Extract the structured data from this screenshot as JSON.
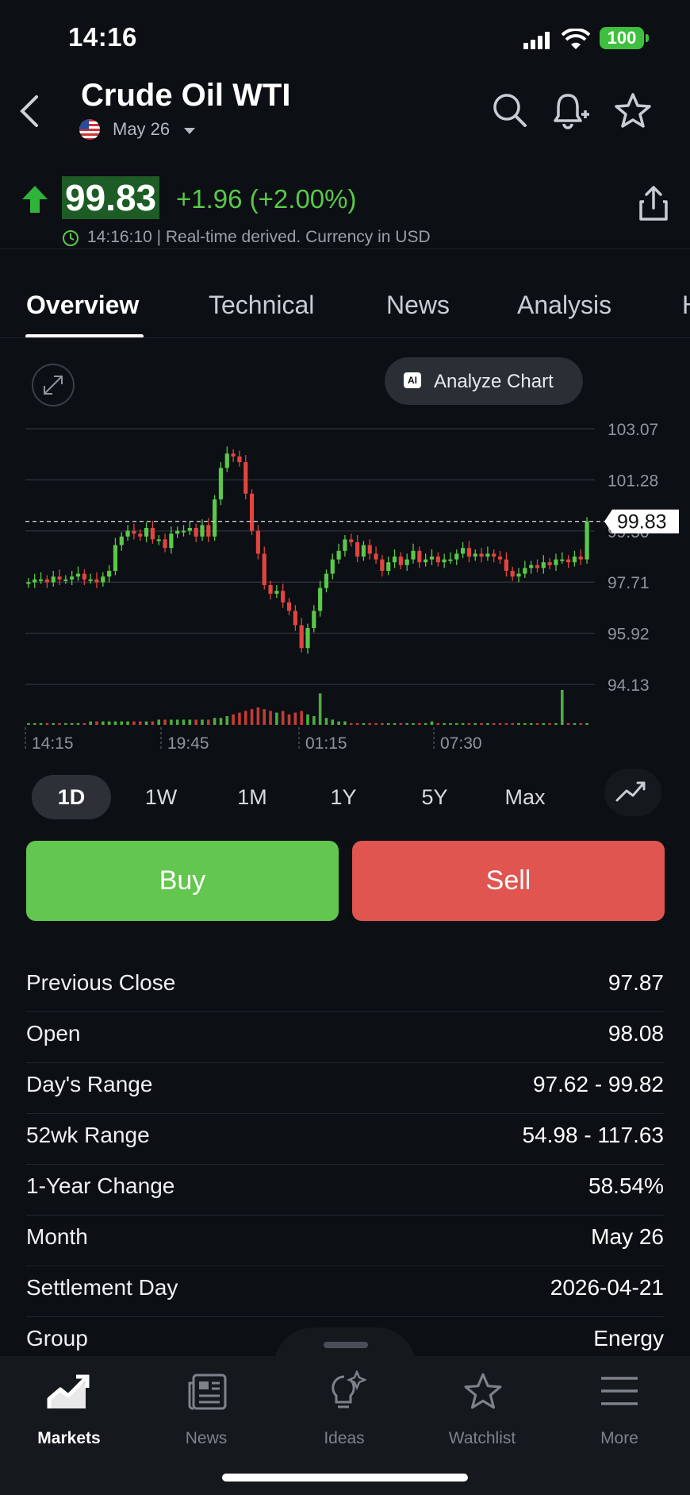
{
  "status_bar": {
    "time": "14:16",
    "battery": "100"
  },
  "header": {
    "title": "Crude Oil WTI",
    "contract": "May 26"
  },
  "quote": {
    "price": "99.83",
    "change": "+1.96 (+2.00%)",
    "meta": "14:16:10 | Real-time derived. Currency in USD",
    "direction": "up",
    "up_color": "#5ac84a",
    "down_color": "#e0453f"
  },
  "tabs": [
    "Overview",
    "Technical",
    "News",
    "Analysis",
    "H"
  ],
  "analyze_button": {
    "badge": "AI",
    "label": "Analyze Chart"
  },
  "chart_data": {
    "type": "candlestick",
    "y_ticks": [
      "103.07",
      "101.28",
      "99.50",
      "97.71",
      "95.92",
      "94.13"
    ],
    "x_ticks": [
      "14:15",
      "19:45",
      "01:15",
      "07:30"
    ],
    "ylim": [
      94.13,
      103.07
    ],
    "current_price_label": "99.83",
    "closes": [
      97.7,
      97.8,
      97.8,
      97.7,
      97.9,
      97.8,
      97.8,
      97.9,
      98.0,
      97.8,
      97.8,
      97.7,
      97.9,
      98.1,
      99.0,
      99.3,
      99.5,
      99.4,
      99.3,
      99.6,
      99.2,
      99.2,
      98.9,
      99.4,
      99.5,
      99.5,
      99.6,
      99.3,
      99.7,
      99.3,
      100.6,
      101.7,
      102.2,
      102.1,
      101.9,
      100.8,
      99.5,
      98.7,
      97.6,
      97.3,
      97.4,
      97.0,
      96.7,
      96.2,
      95.4,
      96.1,
      96.7,
      97.5,
      98.0,
      98.5,
      98.8,
      99.2,
      99.1,
      98.6,
      99.0,
      98.7,
      98.5,
      98.1,
      98.4,
      98.6,
      98.3,
      98.5,
      98.8,
      98.4,
      98.5,
      98.6,
      98.4,
      98.5,
      98.5,
      98.7,
      98.9,
      98.6,
      98.7,
      98.6,
      98.7,
      98.6,
      98.5,
      98.1,
      97.9,
      98.0,
      98.2,
      98.3,
      98.2,
      98.4,
      98.3,
      98.5,
      98.5,
      98.4,
      98.6,
      98.5,
      99.83
    ],
    "volume": [
      1,
      1,
      1,
      1,
      1,
      1,
      1,
      1,
      1,
      1,
      2,
      2,
      2,
      2,
      2,
      2,
      2,
      2,
      2,
      2,
      2,
      3,
      3,
      3,
      3,
      3,
      3,
      3,
      3,
      3,
      4,
      4,
      5,
      6,
      7,
      8,
      9,
      10,
      9,
      8,
      7,
      8,
      6,
      7,
      8,
      6,
      5,
      18,
      4,
      3,
      2,
      2,
      1,
      1,
      1,
      1,
      1,
      1,
      1,
      1,
      1,
      1,
      1,
      1,
      1,
      2,
      1,
      1,
      1,
      1,
      1,
      1,
      1,
      1,
      1,
      1,
      1,
      1,
      1,
      1,
      1,
      1,
      1,
      1,
      1,
      1,
      20,
      1,
      1,
      1,
      1
    ]
  },
  "periods": [
    "1D",
    "1W",
    "1M",
    "1Y",
    "5Y",
    "Max"
  ],
  "active_period": "1D",
  "actions": {
    "buy": "Buy",
    "sell": "Sell"
  },
  "stats": [
    {
      "label": "Previous Close",
      "value": "97.87"
    },
    {
      "label": "Open",
      "value": "98.08"
    },
    {
      "label": "Day's Range",
      "value": "97.62 - 99.82"
    },
    {
      "label": "52wk Range",
      "value": "54.98 - 117.63"
    },
    {
      "label": "1-Year Change",
      "value": "58.54%"
    },
    {
      "label": "Month",
      "value": "May 26"
    },
    {
      "label": "Settlement Day",
      "value": "2026-04-21"
    },
    {
      "label": "Group",
      "value": "Energy"
    }
  ],
  "nav": [
    {
      "label": "Markets",
      "icon": "markets-icon"
    },
    {
      "label": "News",
      "icon": "news-icon"
    },
    {
      "label": "Ideas",
      "icon": "ideas-icon"
    },
    {
      "label": "Watchlist",
      "icon": "star-icon"
    },
    {
      "label": "More",
      "icon": "menu-icon"
    }
  ]
}
